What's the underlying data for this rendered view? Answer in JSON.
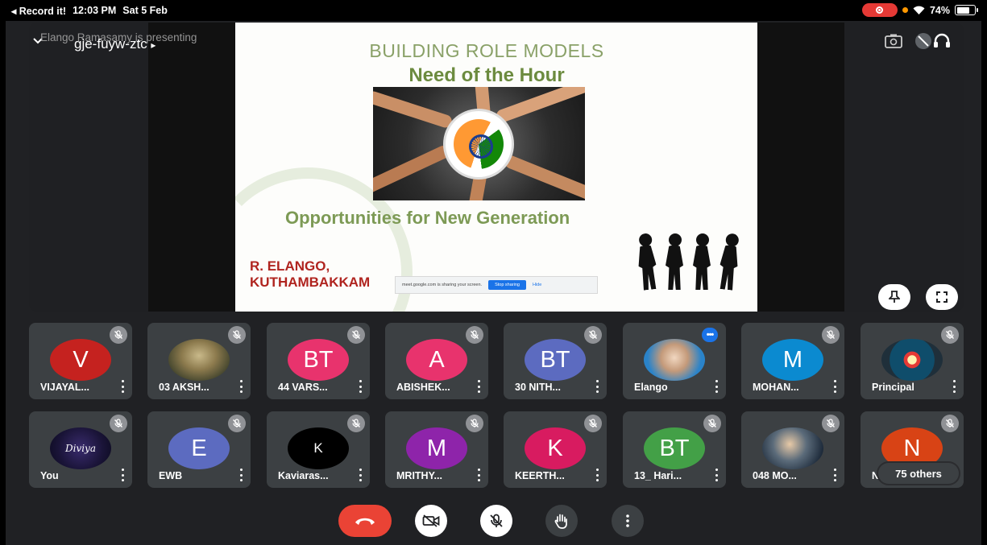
{
  "status": {
    "back_label": "◂ Record it!",
    "time": "12:03 PM",
    "date": "Sat 5 Feb",
    "battery": "74%",
    "battery_level": 0.74
  },
  "meeting": {
    "presenting_text": "Elango Ramasamy is presenting",
    "code": "gje-fuyw-ztc",
    "code_arrow": "▸"
  },
  "slide": {
    "title": "BUILDING ROLE MODELS",
    "subtitle": "Need of the Hour",
    "tagline": "Opportunities for New Generation",
    "author_line1": "R. ELANGO,",
    "author_line2": "KUTHAMBAKKAM",
    "share_notice": "meet.google.com is sharing your screen.",
    "share_stop": "Stop sharing",
    "share_hide": "Hide"
  },
  "participants": [
    {
      "name": "VIJAYAL...",
      "initial": "V",
      "color": "#c5221f",
      "kind": "letter"
    },
    {
      "name": "03 AKSH...",
      "initial": "",
      "color": "",
      "kind": "photo-landscape"
    },
    {
      "name": "44 VARS...",
      "initial": "BT",
      "color": "#e8336d",
      "kind": "letter"
    },
    {
      "name": "ABISHEK...",
      "initial": "A",
      "color": "#e8336d",
      "kind": "letter"
    },
    {
      "name": "30 NITH...",
      "initial": "BT",
      "color": "#5c6bc0",
      "kind": "letter"
    },
    {
      "name": "Elango",
      "initial": "",
      "color": "",
      "kind": "photo-portrait"
    },
    {
      "name": "MOHAN...",
      "initial": "M",
      "color": "#0b8ad0",
      "kind": "letter"
    },
    {
      "name": "Principal",
      "initial": "",
      "color": "",
      "kind": "photo-seal"
    },
    {
      "name": "You",
      "initial": "",
      "color": "",
      "kind": "photo-divya"
    },
    {
      "name": "EWB",
      "initial": "E",
      "color": "#5c6bc0",
      "kind": "letter"
    },
    {
      "name": "Kaviaras...",
      "initial": "K",
      "color": "#000000",
      "kind": "letter-small"
    },
    {
      "name": "MRITHY...",
      "initial": "M",
      "color": "#8e24aa",
      "kind": "letter"
    },
    {
      "name": "KEERTH...",
      "initial": "K",
      "color": "#d81b60",
      "kind": "letter"
    },
    {
      "name": "13_ Hari...",
      "initial": "BT",
      "color": "#43a047",
      "kind": "letter"
    },
    {
      "name": "048 MO...",
      "initial": "",
      "color": "",
      "kind": "photo-movie"
    },
    {
      "name": "N",
      "initial": "N",
      "color": "#d84315",
      "kind": "letter"
    }
  ],
  "others_label": "75 others",
  "divya_text": "Diviya",
  "colors": {
    "end_call": "#ea4335",
    "tile_bg": "#3c4043",
    "frame_bg": "#202124",
    "accent": "#1a73e8"
  }
}
